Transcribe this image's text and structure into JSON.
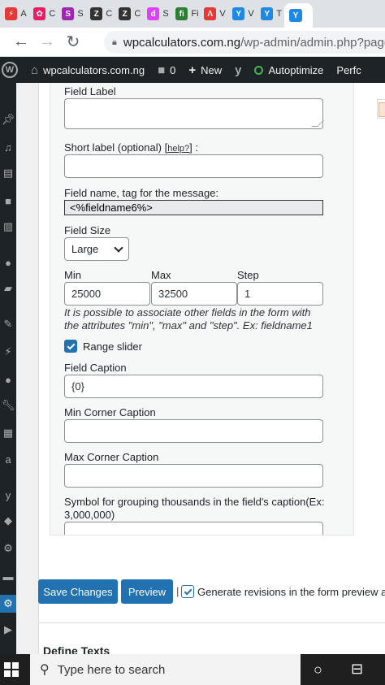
{
  "browser": {
    "tabs": [
      {
        "letter": "⚡",
        "color": "#e53935",
        "label": "A",
        "active": false
      },
      {
        "letter": "✿",
        "color": "#e91e63",
        "label": "C",
        "active": false
      },
      {
        "letter": "S",
        "color": "#9c27b0",
        "label": "S",
        "active": false
      },
      {
        "letter": "Z",
        "color": "#333333",
        "label": "C",
        "active": false
      },
      {
        "letter": "Z",
        "color": "#333333",
        "label": "C",
        "active": false
      },
      {
        "letter": "d",
        "color": "#e040fb",
        "label": "S",
        "active": false
      },
      {
        "letter": "fi",
        "color": "#2e7d32",
        "label": "Fi",
        "active": false
      },
      {
        "letter": "Λ",
        "color": "#e53935",
        "label": "V",
        "active": false
      },
      {
        "letter": "Y",
        "color": "#1e88e5",
        "label": "V",
        "active": false
      },
      {
        "letter": "Y",
        "color": "#1e88e5",
        "label": "T",
        "active": false
      },
      {
        "letter": "Y",
        "color": "#1e88e5",
        "label": "",
        "active": true
      }
    ],
    "url_host": "wpcalculators.com.ng",
    "url_path": "/wp-admin/admin.php?page=c"
  },
  "adminbar": {
    "site": "wpcalculators.com.ng",
    "comments": "0",
    "new_label": "New",
    "autoptimize": "Autoptimize",
    "perf": "Perfc"
  },
  "field": {
    "field_label": "Field Label",
    "short_label": "Short label (optional)",
    "help_link": "help?",
    "short_label_suffix": ":",
    "field_name_label": "Field name, tag for the message:",
    "field_name_value": "<%fieldname6%>",
    "field_size_label": "Field Size",
    "field_size_value": "Large",
    "min_label": "Min",
    "max_label": "Max",
    "step_label": "Step",
    "min_value": "25000",
    "max_value": "32500",
    "step_value": "1",
    "hint": "It is possible to associate other fields in the form with the attributes \"min\", \"max\" and \"step\". Ex: fieldname1",
    "range_slider_label": "Range slider",
    "range_slider_checked": true,
    "field_caption_label": "Field Caption",
    "field_caption_value": "{0}",
    "min_corner_label": "Min Corner Caption",
    "max_corner_label": "Max Corner Caption",
    "grouping_label": "Symbol for grouping thousands in the field's caption(Ex: 3,000,000)"
  },
  "actions": {
    "save_label": "Save Changes",
    "preview_label": "Preview",
    "separator": "|",
    "revisions_label": "Generate revisions in the form preview as"
  },
  "define_texts": "Define Texts",
  "taskbar": {
    "search_placeholder": "Type here to search"
  }
}
